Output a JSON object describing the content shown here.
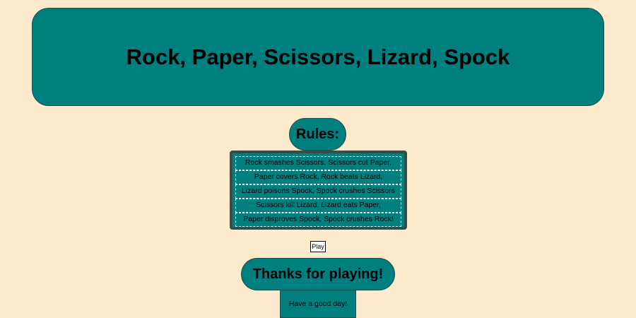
{
  "header": {
    "title": "Rock, Paper, Scissors, Lizard, Spock"
  },
  "rules": {
    "title": "Rules:",
    "lines": [
      "Rock smashes Scissors, Scissors cut Paper,",
      "Paper covers Rock, Rock beats Lizard,",
      "Lizard poisons Spock, Spock crushes Scissors",
      "Scissors kill Lizard, Lizard eats Paper,",
      "Paper disproves Spock, Spock crushes Rock!"
    ]
  },
  "play_button": {
    "label": "Play"
  },
  "footer": {
    "thanks": "Thanks for playing!",
    "good_day": "Have a good day!"
  },
  "colors": {
    "background": "#feeacd",
    "panel": "#007f7f",
    "rules_border": "#2f4f4f"
  }
}
